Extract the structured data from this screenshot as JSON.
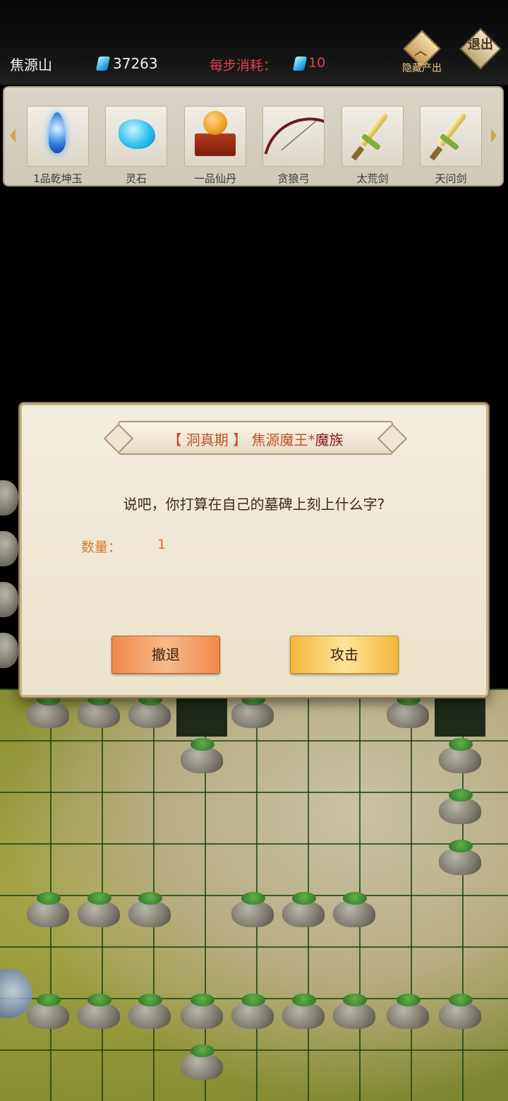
{
  "header": {
    "location": "焦源山",
    "spirit_stones": "37263",
    "cost_label": "每步消耗：",
    "cost_value": "10",
    "hide_label": "隐藏产出",
    "exit_label": "退出"
  },
  "items": [
    {
      "name": "1品乾坤玉",
      "icon": "jade-icon"
    },
    {
      "name": "灵石",
      "icon": "spirit-stone-icon"
    },
    {
      "name": "一品仙丹",
      "icon": "elixir-icon"
    },
    {
      "name": "贪狼弓",
      "icon": "bow-icon"
    },
    {
      "name": "太荒剑",
      "icon": "sword-icon"
    },
    {
      "name": "天问剑",
      "icon": "sword-icon"
    }
  ],
  "dialog": {
    "title_prefix": "【 洞真期 】 焦源魔王*",
    "title_race": "魔族",
    "question": "说吧，你打算在自己的墓碑上刻上什么字?",
    "quantity_label": "数量：",
    "quantity_value": "1",
    "retreat_label": "撤退",
    "attack_label": "攻击"
  },
  "colors": {
    "cost_text": "#e0414f",
    "title_text": "#c0522a",
    "race_text": "#8b1a1a",
    "quantity_text": "#d9782c"
  }
}
